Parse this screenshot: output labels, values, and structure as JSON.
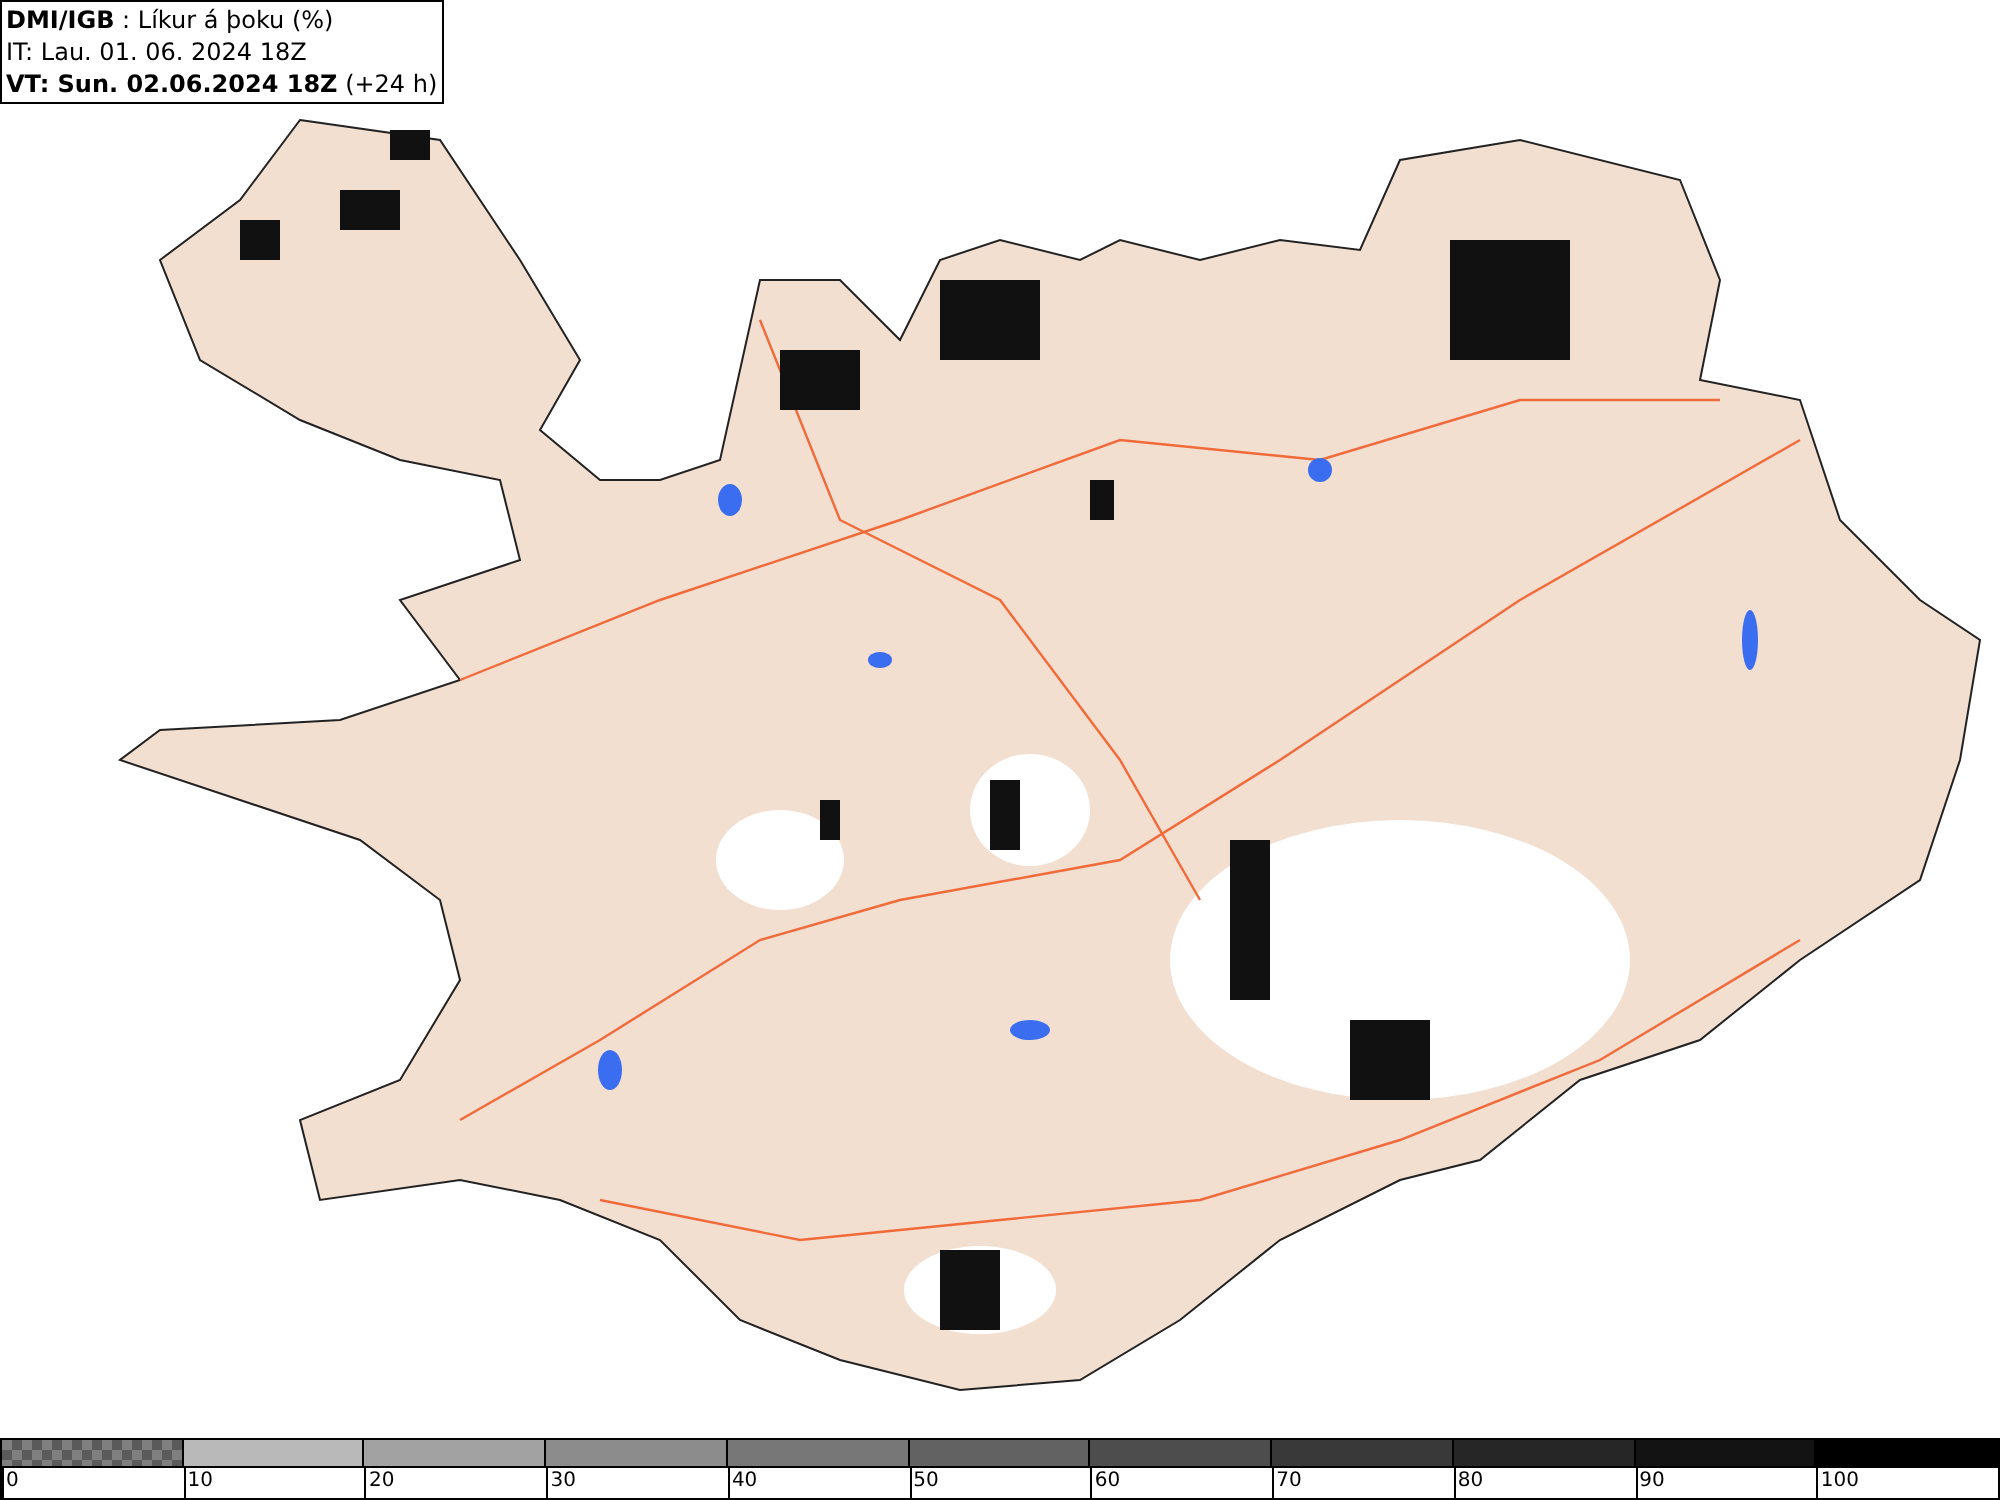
{
  "header": {
    "lines": [
      "**DMI/IGB** : Líkur á þoku (%)",
      "IT: Lau. 01. 06. 2024 18Z",
      "**VT: Sun. 02.06.2024 18Z** (+24 h)"
    ]
  },
  "legend": {
    "segments": [
      {
        "kind": "checker",
        "color": "#7f7f7f",
        "label": "0"
      },
      {
        "kind": "solid",
        "color": "#b9b9b9",
        "label": "10"
      },
      {
        "kind": "solid",
        "color": "#a2a2a2",
        "label": "20"
      },
      {
        "kind": "solid",
        "color": "#8c8c8c",
        "label": "30"
      },
      {
        "kind": "solid",
        "color": "#777777",
        "label": "40"
      },
      {
        "kind": "solid",
        "color": "#626262",
        "label": "50"
      },
      {
        "kind": "solid",
        "color": "#4d4d4d",
        "label": "60"
      },
      {
        "kind": "solid",
        "color": "#393939",
        "label": "70"
      },
      {
        "kind": "solid",
        "color": "#262626",
        "label": "80"
      },
      {
        "kind": "solid",
        "color": "#131313",
        "label": "90"
      },
      {
        "kind": "solid",
        "color": "#000000",
        "label": "100"
      }
    ]
  }
}
